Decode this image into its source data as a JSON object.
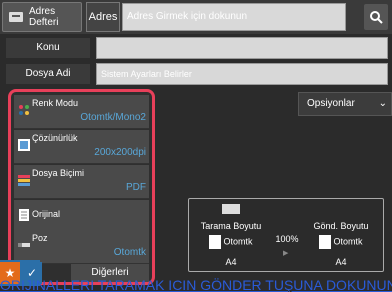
{
  "topbar": {
    "addressbook_label": "Adres Defteri",
    "address_label": "Adres",
    "address_input_placeholder": "Adres Girmek için dokunun"
  },
  "form": {
    "konu_label": "Konu",
    "konu_value": "",
    "dosya_adi_label": "Dosya Adi",
    "dosya_adi_placeholder": "Sistem Ayarları Belirler"
  },
  "options_label": "Opsiyonlar",
  "settings": [
    {
      "title": "Renk Modu",
      "value": "Otomtk/Mono2"
    },
    {
      "title": "Çözünürlük",
      "value": "200x200dpi"
    },
    {
      "title": "Dosya Biçimi",
      "value": "PDF"
    },
    {
      "title": "Orijinal",
      "value": ""
    },
    {
      "title": "Poz",
      "value": "Otomtk"
    }
  ],
  "others_label": "Diğerleri",
  "preview": {
    "scan_size_label": "Tarama Boyutu",
    "scan_size_value": "Otomtk",
    "scan_paper": "A4",
    "ratio": "100%",
    "send_size_label": "Gönd. Boyutu",
    "send_size_value": "Otomtk",
    "send_paper": "A4"
  },
  "bottom_link_text": "ORIJINALLERI TARAMAK ICIN GÖNDER TUŞUNA DOKUNUN"
}
